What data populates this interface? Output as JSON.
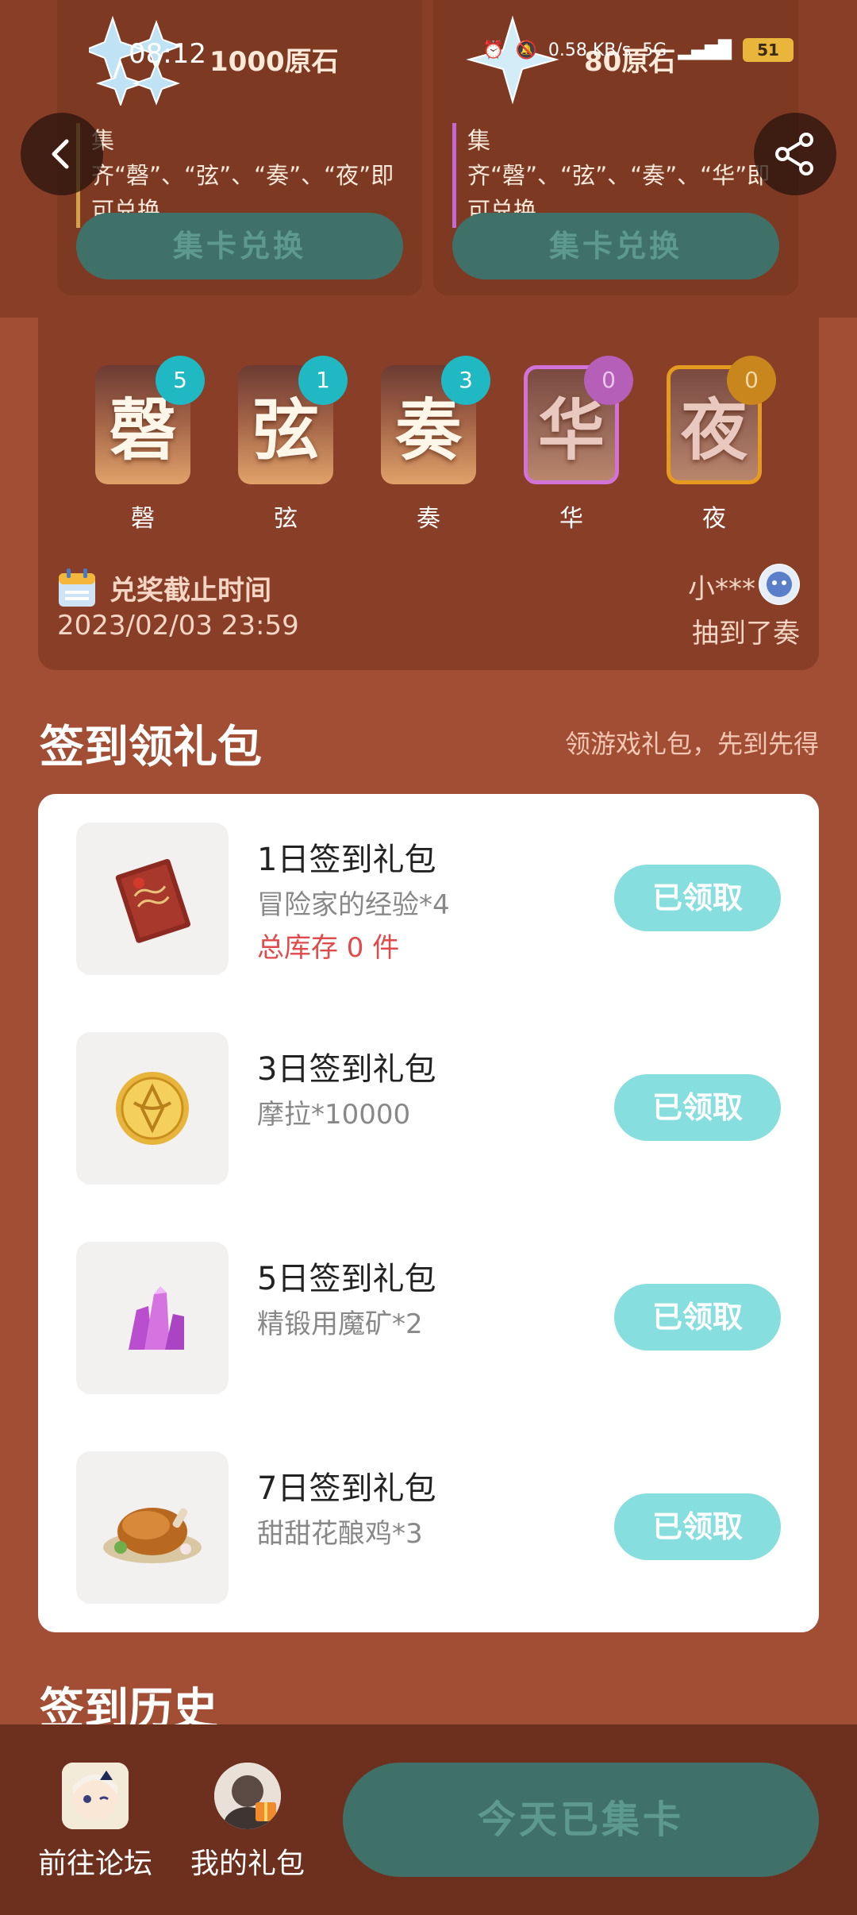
{
  "status_bar": {
    "time": "08:12",
    "speed": "0.58 KB/s",
    "network": "5G",
    "battery": "51"
  },
  "rewards": [
    {
      "title": "1000原石",
      "desc": "集齐“磬”、“弦”、“奏”、“夜”即可兑换",
      "button": "集卡兑换"
    },
    {
      "title": "80原石",
      "desc": "集齐“磬”、“弦”、“奏”、“华”即可兑换",
      "button": "集卡兑换"
    }
  ],
  "cards": [
    {
      "char": "磬",
      "label": "磬",
      "count": "5"
    },
    {
      "char": "弦",
      "label": "弦",
      "count": "1"
    },
    {
      "char": "奏",
      "label": "奏",
      "count": "3"
    },
    {
      "char": "华",
      "label": "华",
      "count": "0"
    },
    {
      "char": "夜",
      "label": "夜",
      "count": "0"
    }
  ],
  "deadline": {
    "title": "兑奖截止时间",
    "date": "2023/02/03 23:59"
  },
  "winner": {
    "name": "小***",
    "text": "抽到了奏"
  },
  "signin": {
    "title": "签到领礼包",
    "subtitle": "领游戏礼包，先到先得",
    "gifts": [
      {
        "name": "1日签到礼包",
        "content": "冒险家的经验*4",
        "stock": "总库存 0 件",
        "button": "已领取",
        "icon": "book-icon"
      },
      {
        "name": "3日签到礼包",
        "content": "摩拉*10000",
        "button": "已领取",
        "icon": "coin-icon"
      },
      {
        "name": "5日签到礼包",
        "content": "精锻用魔矿*2",
        "button": "已领取",
        "icon": "crystal-icon"
      },
      {
        "name": "7日签到礼包",
        "content": "甜甜花酿鸡*3",
        "button": "已领取",
        "icon": "chicken-icon"
      }
    ]
  },
  "history": {
    "title": "签到历史"
  },
  "bottom_nav": {
    "forum": "前往论坛",
    "gifts": "我的礼包",
    "today": "今天已集卡"
  },
  "colors": {
    "background": "#a24e34",
    "panel": "#893e28",
    "teal_button": "#3f7168",
    "claimed": "#87dedf",
    "badge": "#1fb8c3"
  }
}
